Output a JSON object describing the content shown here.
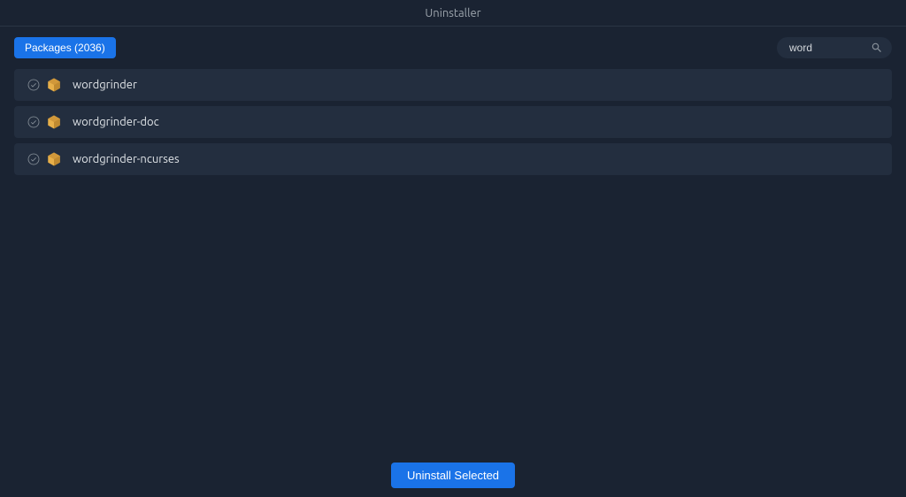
{
  "window": {
    "title": "Uninstaller"
  },
  "toolbar": {
    "packages_label": "Packages (2036)",
    "search_value": "word"
  },
  "packages": [
    {
      "name": "wordgrinder"
    },
    {
      "name": "wordgrinder-doc"
    },
    {
      "name": "wordgrinder-ncurses"
    }
  ],
  "actions": {
    "uninstall_label": "Uninstall Selected"
  }
}
